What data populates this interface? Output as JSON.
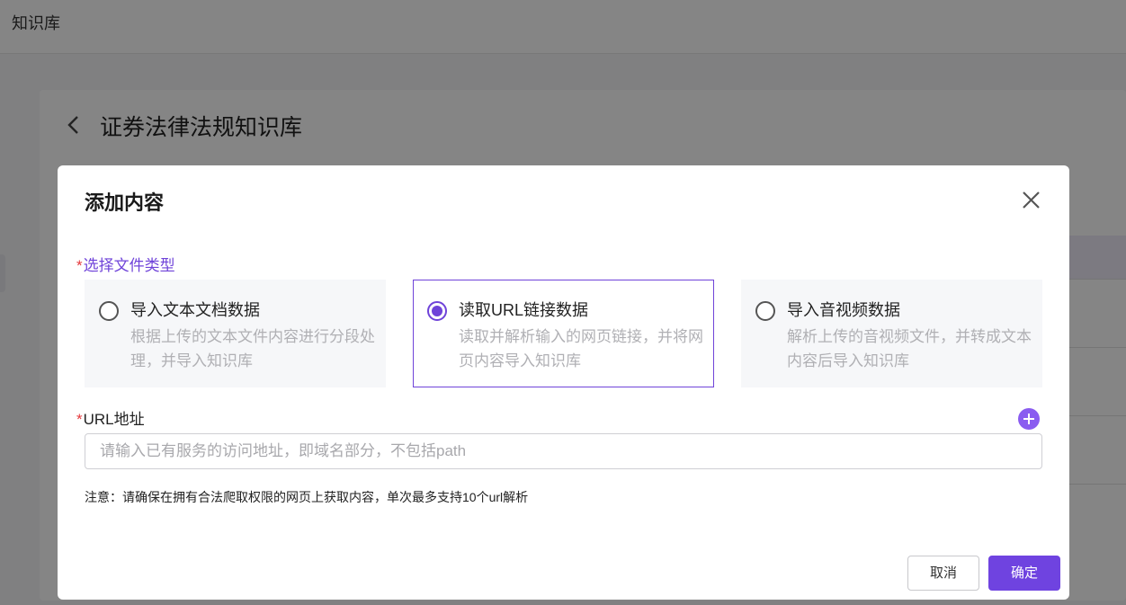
{
  "app": {
    "title": "知识库"
  },
  "background": {
    "page_title": "证券法律法规知识库"
  },
  "modal": {
    "title": "添加内容",
    "file_type_label": "选择文件类型",
    "required_mark": "*",
    "options": [
      {
        "title": "导入文本文档数据",
        "desc": "根据上传的文本文件内容进行分段处理，并导入知识库",
        "selected": false
      },
      {
        "title": "读取URL链接数据",
        "desc": "读取并解析输入的网页链接，并将网页内容导入知识库",
        "selected": true
      },
      {
        "title": "导入音视频数据",
        "desc": "解析上传的音视频文件，并转成文本内容后导入知识库",
        "selected": false
      }
    ],
    "url_label": "URL地址",
    "url_value": "",
    "url_placeholder": "请输入已有服务的访问地址，即域名部分，不包括path",
    "note": "注意：请确保在拥有合法爬取权限的网页上获取内容，单次最多支持10个url解析",
    "cancel_label": "取消",
    "ok_label": "确定"
  },
  "colors": {
    "accent": "#6f43e0",
    "required": "#e5383b",
    "overlay": "rgba(0,0,0,0.48)"
  },
  "icons": {
    "back": "chevron-left-icon",
    "close": "close-icon",
    "add": "plus-circle-icon"
  }
}
